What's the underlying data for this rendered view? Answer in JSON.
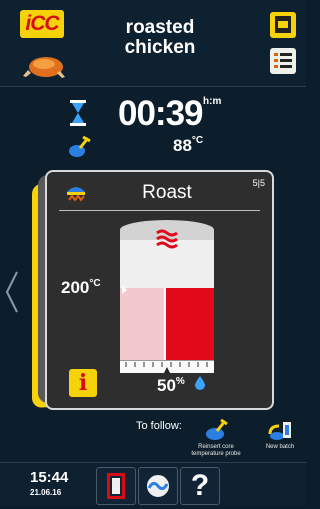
{
  "header": {
    "logo": "iCC",
    "title": "roasted chicken"
  },
  "status": {
    "timer": "00:39",
    "timer_unit": "h:m",
    "core_temp": "88",
    "core_temp_unit": "°C"
  },
  "card": {
    "title": "Roast",
    "page": "5|5",
    "set_temp": "200",
    "set_temp_unit": "°C",
    "humidity": "50",
    "humidity_unit": "%",
    "humidity_level": 0.5,
    "info_label": "i"
  },
  "to_follow": {
    "label": "To follow:",
    "items": [
      {
        "label": "Reinsert core temperature probe",
        "icon": "probe-insert-icon"
      },
      {
        "label": "New batch",
        "icon": "new-batch-icon"
      }
    ]
  },
  "footer": {
    "time": "15:44",
    "date": "21.06.16",
    "help_label": "?"
  },
  "colors": {
    "accent": "#f5d20a",
    "brand_red": "#d80c13",
    "heat_red": "#e10a1a",
    "background": "#0c1e2c"
  }
}
